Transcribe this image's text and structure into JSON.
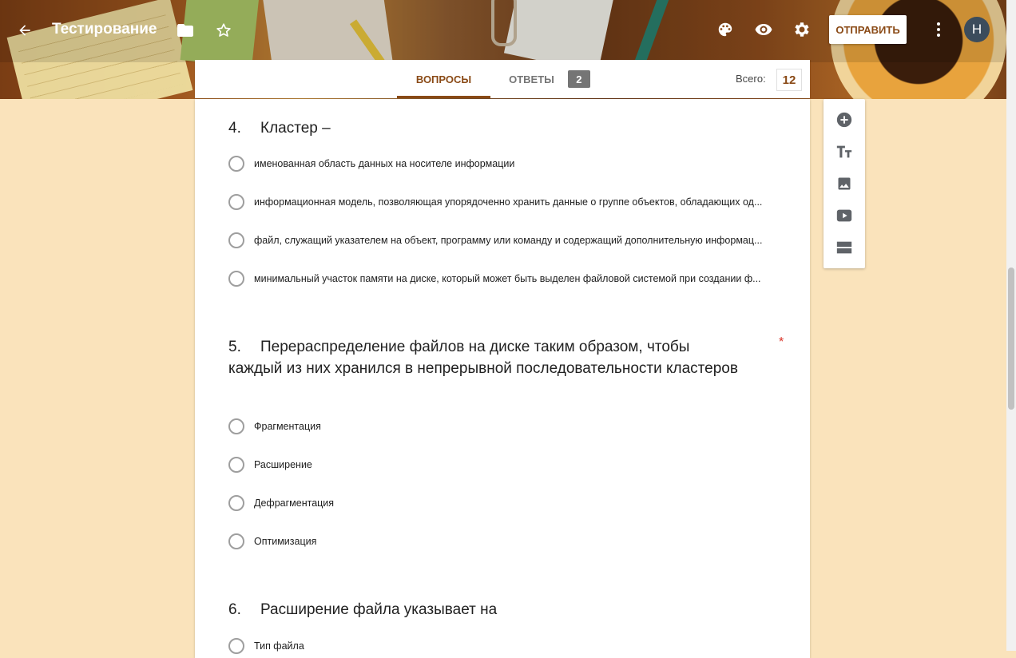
{
  "header": {
    "title": "Тестирование",
    "send_label": "ОТПРАВИТЬ",
    "avatar_letter": "Н",
    "icons": [
      "back-arrow-icon",
      "folder-icon",
      "star-icon",
      "palette-icon",
      "eye-icon",
      "gear-icon",
      "more-vert-icon"
    ]
  },
  "tabs": {
    "questions_label": "ВОПРОСЫ",
    "answers_label": "ОТВЕТЫ",
    "answers_count": "2",
    "total_label": "Всего:",
    "total_value": "12"
  },
  "questions": [
    {
      "number": "4.",
      "title": "Кластер –",
      "required": false,
      "options": [
        "именованная область данных на носителе информации",
        "информационная модель, позволяющая упорядоченно хранить данные о группе объектов, обладающих од...",
        "файл, служащий указателем на объект, программу или команду и содержащий дополнительную информац...",
        "минимальный участок памяти на диске, который может быть выделен файловой системой при создании ф..."
      ]
    },
    {
      "number": "5.",
      "title": "Перераспределение файлов на диске таким образом, чтобы каждый из них хранился в непрерывной последовательности кластеров",
      "required": true,
      "required_mark": "*",
      "options": [
        "Фрагментация",
        "Расширение",
        "Дефрагментация",
        "Оптимизация"
      ]
    },
    {
      "number": "6.",
      "title": "Расширение файла указывает на",
      "required": false,
      "options": [
        "Тип файла"
      ]
    }
  ],
  "side_toolbar": [
    "add-question-icon",
    "title-text-icon",
    "image-icon",
    "video-icon",
    "section-icon"
  ],
  "colors": {
    "accent": "#8a4a16",
    "page_background": "#fae3bb",
    "required": "#d93025"
  }
}
